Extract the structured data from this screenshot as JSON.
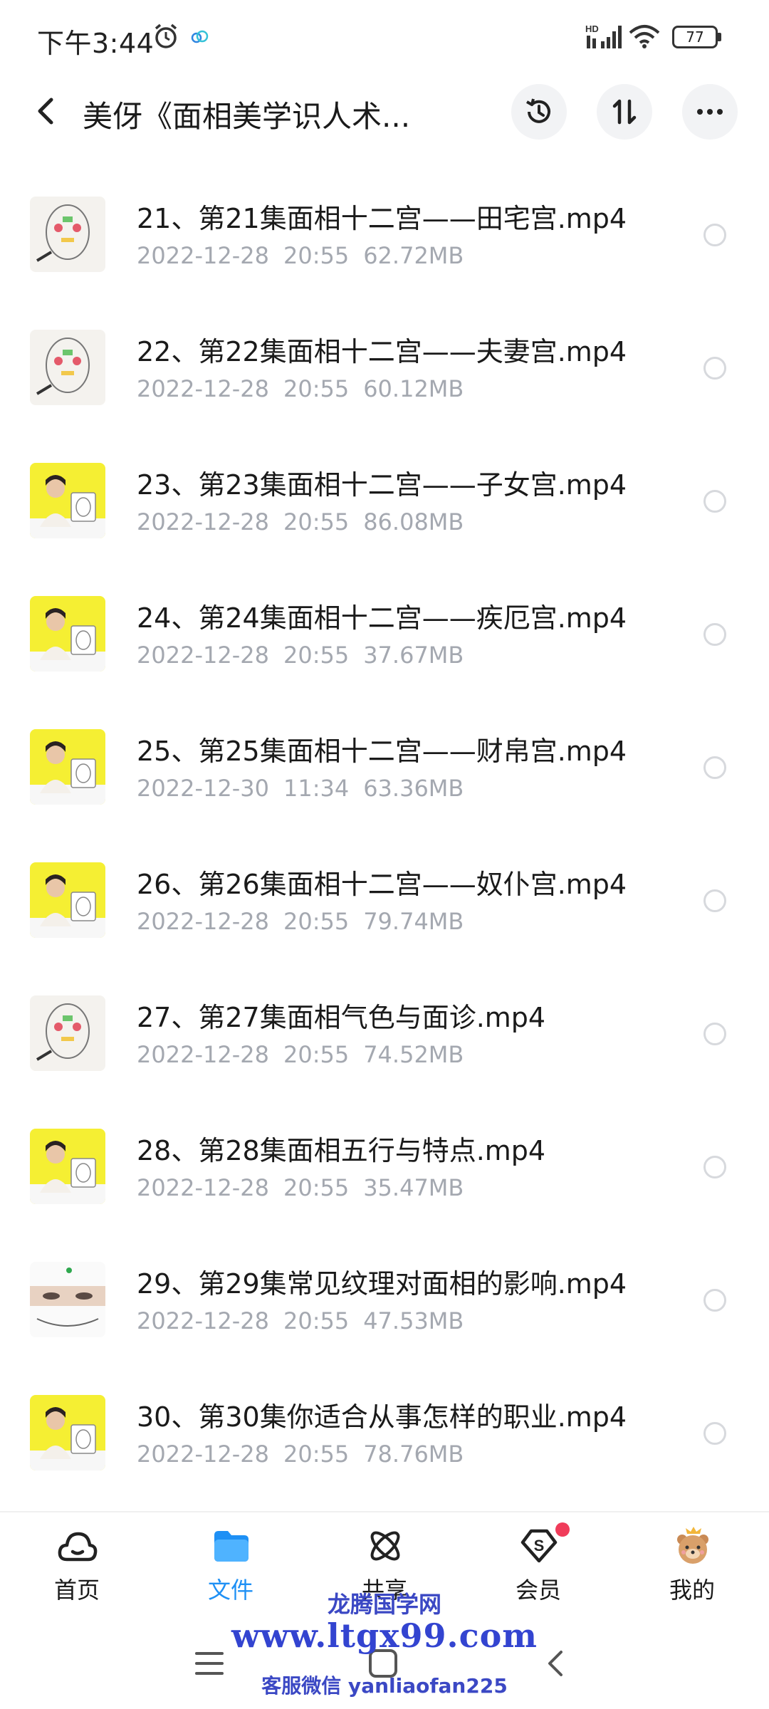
{
  "status_bar": {
    "time": "下午3:44",
    "network": "HD",
    "battery": "77"
  },
  "header": {
    "title": "美伢《面相美学识人术..."
  },
  "files": [
    {
      "name": "21、第21集面相十二宫——田宅宫.mp4",
      "date": "2022-12-28",
      "time": "20:55",
      "size": "62.72MB",
      "thumb": "drawing"
    },
    {
      "name": "22、第22集面相十二宫——夫妻宫.mp4",
      "date": "2022-12-28",
      "time": "20:55",
      "size": "60.12MB",
      "thumb": "drawing"
    },
    {
      "name": "23、第23集面相十二宫——子女宫.mp4",
      "date": "2022-12-28",
      "time": "20:55",
      "size": "86.08MB",
      "thumb": "yellow"
    },
    {
      "name": "24、第24集面相十二宫——疾厄宫.mp4",
      "date": "2022-12-28",
      "time": "20:55",
      "size": "37.67MB",
      "thumb": "yellow"
    },
    {
      "name": "25、第25集面相十二宫——财帛宫.mp4",
      "date": "2022-12-30",
      "time": "11:34",
      "size": "63.36MB",
      "thumb": "yellow"
    },
    {
      "name": "26、第26集面相十二宫——奴仆宫.mp4",
      "date": "2022-12-28",
      "time": "20:55",
      "size": "79.74MB",
      "thumb": "yellow"
    },
    {
      "name": "27、第27集面相气色与面诊.mp4",
      "date": "2022-12-28",
      "time": "20:55",
      "size": "74.52MB",
      "thumb": "drawing"
    },
    {
      "name": "28、第28集面相五行与特点.mp4",
      "date": "2022-12-28",
      "time": "20:55",
      "size": "35.47MB",
      "thumb": "yellow"
    },
    {
      "name": "29、第29集常见纹理对面相的影响.mp4",
      "date": "2022-12-28",
      "time": "20:55",
      "size": "47.53MB",
      "thumb": "eyes"
    },
    {
      "name": "30、第30集你适合从事怎样的职业.mp4",
      "date": "2022-12-28",
      "time": "20:55",
      "size": "78.76MB",
      "thumb": "yellow"
    }
  ],
  "bottom_nav": [
    {
      "label": "首页",
      "icon": "cloud-home-icon",
      "active": false
    },
    {
      "label": "文件",
      "icon": "folder-icon",
      "active": true
    },
    {
      "label": "共享",
      "icon": "atom-icon",
      "active": false
    },
    {
      "label": "会员",
      "icon": "vip-s-icon",
      "active": false
    },
    {
      "label": "我的",
      "icon": "bear-avatar-icon",
      "active": false
    }
  ],
  "watermark": {
    "site_name": "龙腾国学网",
    "url": "www.ltgx99.com",
    "contact": "客服微信 yanliaofan225"
  },
  "colors": {
    "accent": "#1e90f5",
    "meta_text": "#a4a8b0",
    "badge": "#f03c5a"
  }
}
